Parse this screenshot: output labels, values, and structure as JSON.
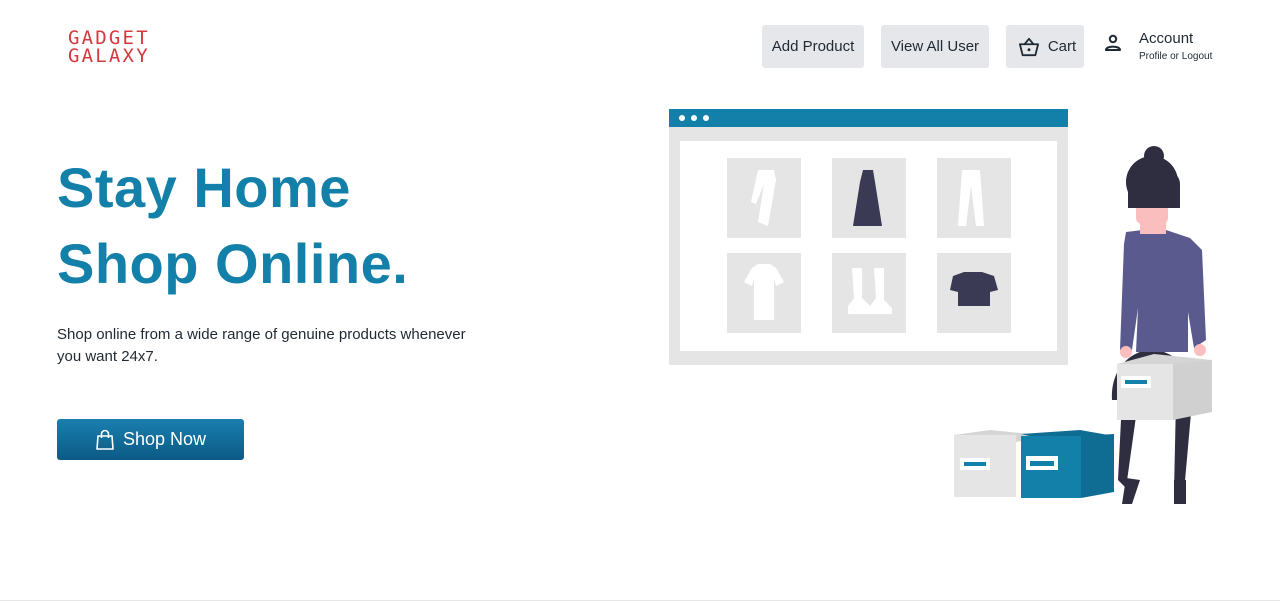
{
  "brand": {
    "line1": "GADGET",
    "line2": "GALAXY",
    "color": "#d4393d"
  },
  "nav": {
    "add_product": "Add Product",
    "view_all_user": "View All User",
    "cart": "Cart",
    "account": "Account",
    "account_sub": "Profile or Logout"
  },
  "hero": {
    "title_line1": "Stay Home",
    "title_line2": "Shop Online.",
    "description": "Shop online from a wide range of genuine products whenever you want 24x7.",
    "cta": "Shop Now",
    "accent": "#1280a8"
  },
  "icons": {
    "cart": "basket-icon",
    "account": "user-icon",
    "cta": "shopping-bag-icon"
  }
}
